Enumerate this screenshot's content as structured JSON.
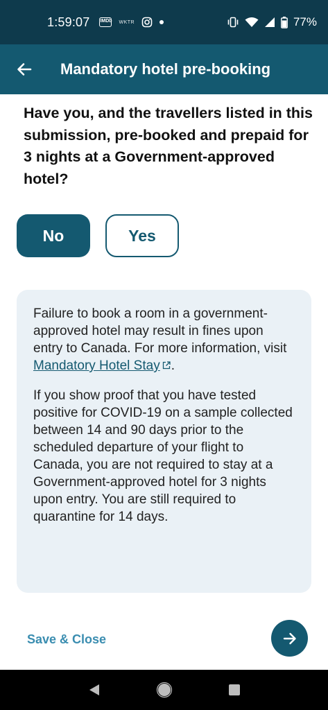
{
  "status_bar": {
    "time": "1:59:07",
    "notif_box_label": "IMDb",
    "notif_text": "WKTR",
    "battery": "77%"
  },
  "app_bar": {
    "title": "Mandatory hotel pre-booking"
  },
  "question": "Have you, and the travellers listed in this submission, pre-booked and prepaid for 3 nights at a Government-approved hotel?",
  "answers": {
    "no_label": "No",
    "yes_label": "Yes",
    "selected": "No"
  },
  "info": {
    "paragraph1_text": "Failure to book a room in a government-approved hotel may result in fines upon entry to Canada. For more information, visit ",
    "paragraph1_link": "Mandatory Hotel Stay",
    "paragraph1_end": ".",
    "paragraph2": "If you show proof that you have tested positive for COVID-19 on a sample collected between 14 and 90 days prior to the scheduled departure of your flight to Canada, you are not required to stay at a Government-approved hotel for 3 nights upon entry. You are still required to quarantine for 14 days."
  },
  "footer": {
    "save_close_label": "Save & Close"
  },
  "colors": {
    "status_bar": "#0e3a4c",
    "app_bar": "#145970",
    "primary": "#145970",
    "info_bg": "#eaf1f6",
    "link_light": "#3a8db0"
  }
}
